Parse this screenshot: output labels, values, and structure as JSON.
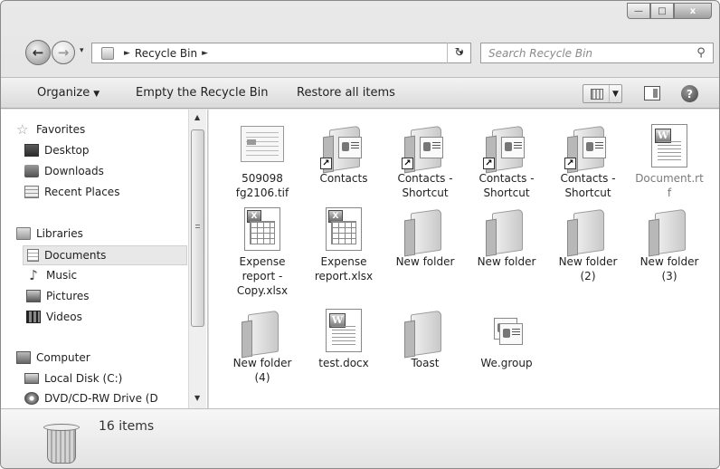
{
  "window": {
    "minimize": "—",
    "maximize": "□",
    "close": "x"
  },
  "nav": {
    "back": "←",
    "forward": "→",
    "history": "▾",
    "breadcrumb_sep": "►",
    "crumb": "Recycle Bin",
    "address_drop": "▾",
    "refresh": "↻",
    "search_placeholder": "Search Recycle Bin",
    "search_icon": "⚲"
  },
  "toolbar": {
    "organize": "Organize",
    "organize_caret": "▼",
    "empty": "Empty the Recycle Bin",
    "restore": "Restore all items",
    "view_caret": "▼",
    "help": "?"
  },
  "navpane": {
    "favorites": "Favorites",
    "desktop": "Desktop",
    "downloads": "Downloads",
    "recent": "Recent Places",
    "libraries": "Libraries",
    "documents": "Documents",
    "music": "Music",
    "pictures": "Pictures",
    "videos": "Videos",
    "computer": "Computer",
    "local_disk": "Local Disk (C:)",
    "dvd": "DVD/CD-RW Drive (D",
    "scroll_up": "▲",
    "scroll_down": "▼"
  },
  "files": [
    {
      "name": "509098\nfg2106.tif",
      "type": "tif"
    },
    {
      "name": "Contacts",
      "type": "contacts"
    },
    {
      "name": "Contacts -\nShortcut",
      "type": "contacts"
    },
    {
      "name": "Contacts -\nShortcut",
      "type": "contacts"
    },
    {
      "name": "Contacts -\nShortcut",
      "type": "contacts"
    },
    {
      "name": "Document.rt\nf",
      "type": "doc"
    },
    {
      "name": "Expense\nreport -\nCopy.xlsx",
      "type": "sheet"
    },
    {
      "name": "Expense\nreport.xlsx",
      "type": "sheet"
    },
    {
      "name": "New folder",
      "type": "folder"
    },
    {
      "name": "New folder",
      "type": "folder"
    },
    {
      "name": "New folder\n(2)",
      "type": "folder"
    },
    {
      "name": "New folder\n(3)",
      "type": "folder"
    },
    {
      "name": "New folder\n(4)",
      "type": "folder"
    },
    {
      "name": "test.docx",
      "type": "doc"
    },
    {
      "name": "Toast",
      "type": "folder"
    },
    {
      "name": "We.group",
      "type": "group"
    }
  ],
  "icons": {
    "shortcut_arrow": "↗",
    "word_badge": "W",
    "excel_badge": "X"
  },
  "details": {
    "count": "16 items"
  }
}
